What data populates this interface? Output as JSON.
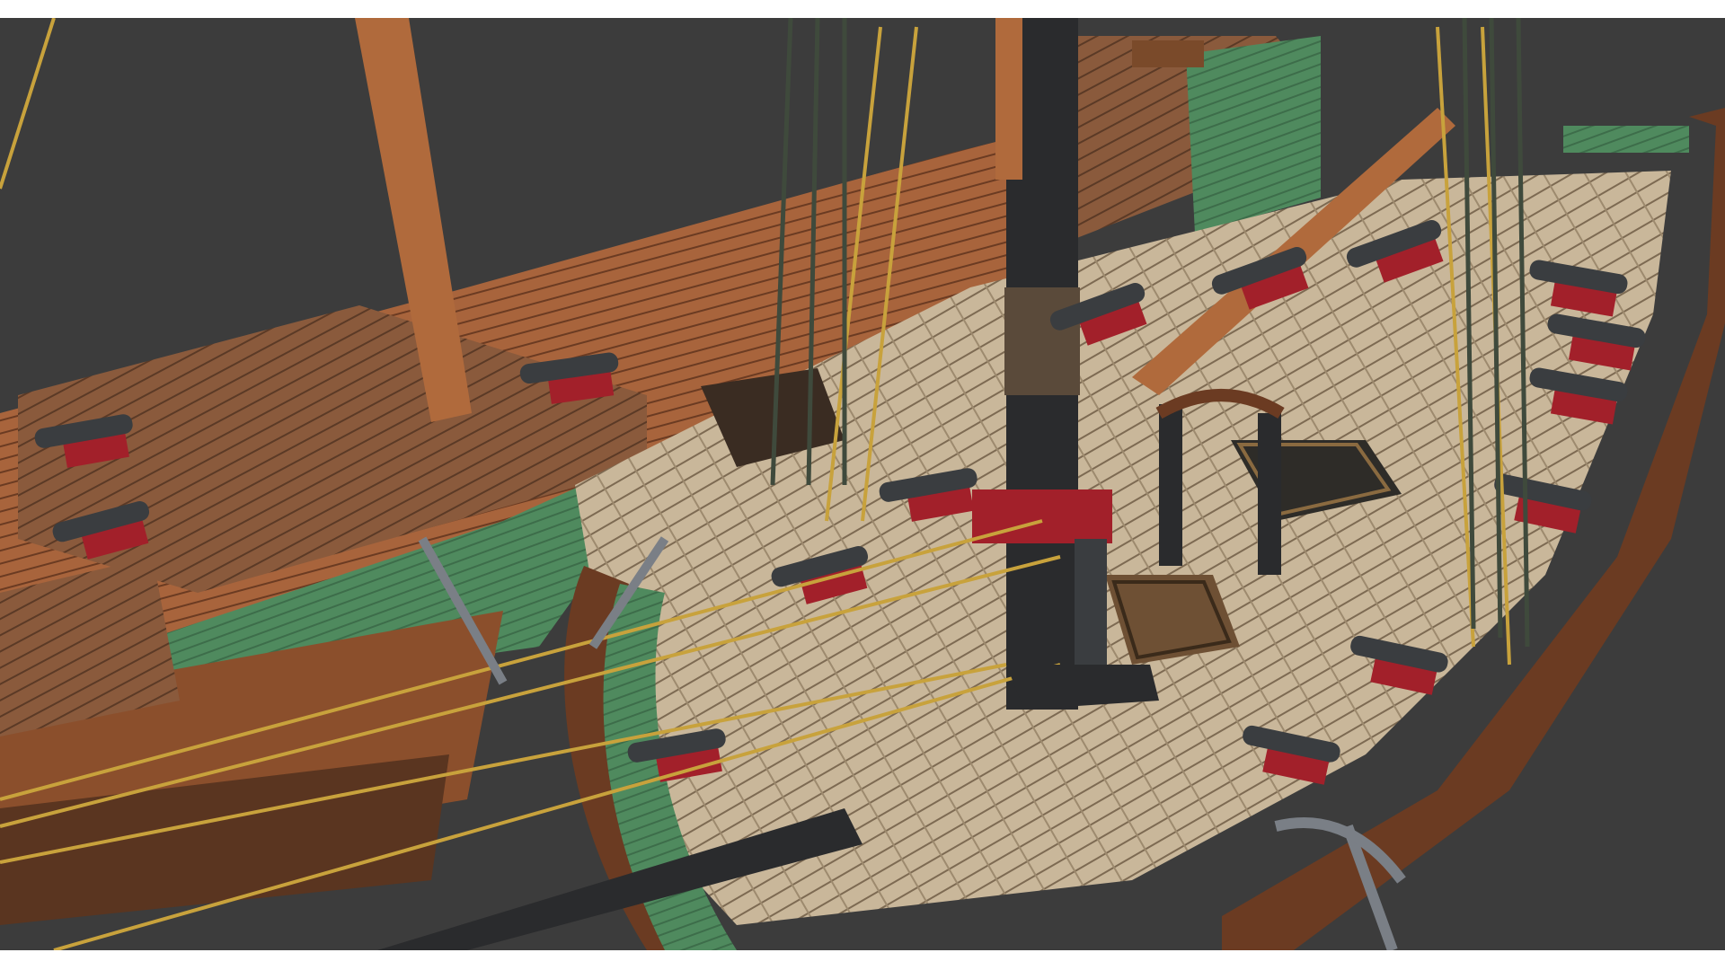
{
  "scene": {
    "subject": "pirate-ship-deck-render",
    "colors": {
      "background": "#3c3c3c",
      "hull_dark_wood": "#6b3b22",
      "hull_light_wood": "#a8643c",
      "hull_green": "#4f8a5e",
      "deck_planks": "#c9b79a",
      "deck_planks_dark": "#8a7256",
      "cannon_iron": "#3a3d40",
      "carriage_red": "#a2202a",
      "mast_black": "#2a2b2d",
      "rope": "#c8a23c",
      "rope_dark": "#3f4a3c"
    }
  }
}
